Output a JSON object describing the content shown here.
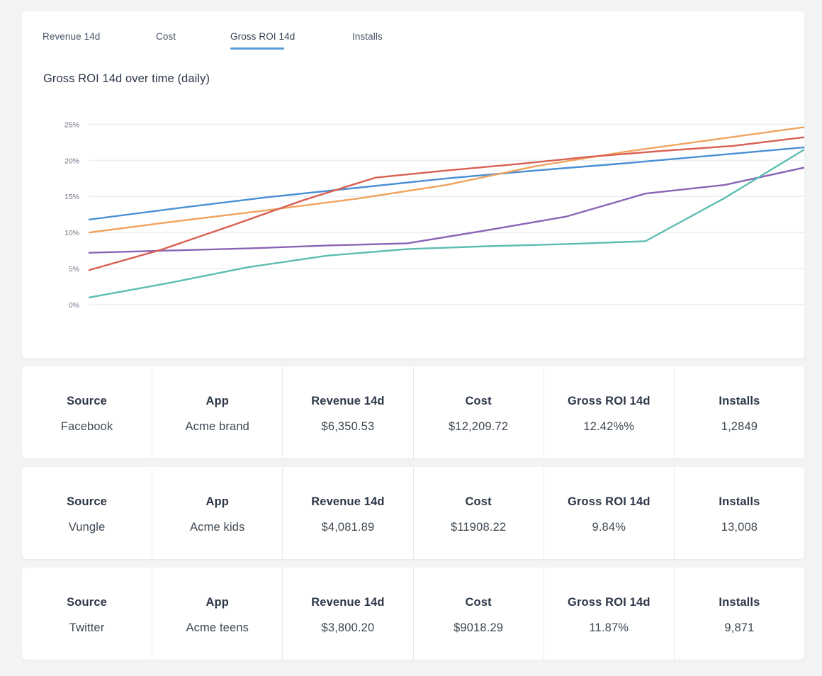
{
  "theme": {
    "page_background": "#f1f3f4",
    "card_background": "#ffffff",
    "accent": "#5b9bd5",
    "text_primary": "#2d3748",
    "text_secondary": "#475467",
    "grid_color": "#eceff3"
  },
  "tabs": [
    {
      "label": "Revenue 14d",
      "active": false
    },
    {
      "label": "Cost",
      "active": false
    },
    {
      "label": "Gross ROI 14d",
      "active": true
    },
    {
      "label": "Installs",
      "active": false
    }
  ],
  "chart_title": "Gross ROI 14d over time (daily)",
  "chart_data": {
    "type": "line",
    "title": "Gross ROI 14d over time (daily)",
    "xlabel": "",
    "ylabel": "",
    "ylim": [
      0,
      27
    ],
    "ytick_values": [
      0,
      5,
      10,
      15,
      20,
      25
    ],
    "ytick_labels": [
      "0%",
      "5%",
      "10%",
      "15%",
      "20%",
      "25%"
    ],
    "grid": "horizontal",
    "legend": "none",
    "x": [
      0,
      1,
      2,
      3,
      4,
      5,
      6,
      7
    ],
    "series": [
      {
        "name": "series-1",
        "color": "#4a8fd4",
        "values": [
          11.8,
          13.4,
          14.9,
          16.2,
          17.5,
          18.6,
          19.6,
          20.7,
          21.8
        ]
      },
      {
        "name": "series-2",
        "color": "#f0a35e",
        "values": [
          10.0,
          11.6,
          13.1,
          14.7,
          16.6,
          19.2,
          21.2,
          22.9,
          24.6
        ]
      },
      {
        "name": "series-3",
        "color": "#8b63b5",
        "values": [
          7.2,
          7.5,
          7.8,
          8.2,
          8.5,
          10.3,
          12.2,
          15.4,
          16.6,
          19.0
        ]
      },
      {
        "name": "series-4",
        "color": "#d95f52",
        "values": [
          4.8,
          7.6,
          11.0,
          14.5,
          17.6,
          18.6,
          19.5,
          20.5,
          21.3,
          22.0,
          23.2
        ]
      },
      {
        "name": "series-5",
        "color": "#5cbdb0",
        "values": [
          1.0,
          3.0,
          5.2,
          6.8,
          7.7,
          8.1,
          8.4,
          8.8,
          14.8,
          21.5
        ]
      }
    ]
  },
  "table": {
    "columns": [
      "Source",
      "App",
      "Revenue 14d",
      "Cost",
      "Gross ROI 14d",
      "Installs"
    ],
    "rows": [
      {
        "source": "Facebook",
        "app": "Acme brand",
        "revenue_14d": "$6,350.53",
        "cost": "$12,209.72",
        "gross_roi_14d": "12.42%%",
        "installs": "1,2849"
      },
      {
        "source": "Vungle",
        "app": "Acme kids",
        "revenue_14d": "$4,081.89",
        "cost": "$11908.22",
        "gross_roi_14d": "9.84%",
        "installs": "13,008"
      },
      {
        "source": "Twitter",
        "app": "Acme teens",
        "revenue_14d": "$3,800.20",
        "cost": "$9018.29",
        "gross_roi_14d": "11.87%",
        "installs": "9,871"
      }
    ]
  }
}
